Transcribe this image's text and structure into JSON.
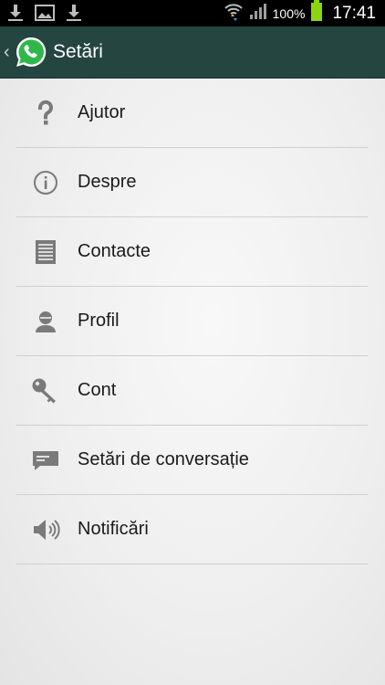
{
  "status_bar": {
    "battery_percent": "100%",
    "time": "17:41",
    "icons": [
      "download-icon",
      "image-icon",
      "download-icon",
      "wifi-icon",
      "signal-icon",
      "battery-icon"
    ]
  },
  "action_bar": {
    "title": "Setări",
    "logo": "whatsapp-logo-icon",
    "colors": {
      "background": "#244540",
      "accent": "#2fb84a"
    }
  },
  "settings": {
    "items": [
      {
        "label": "Ajutor",
        "icon": "help-icon"
      },
      {
        "label": "Despre",
        "icon": "info-icon"
      },
      {
        "label": "Contacte",
        "icon": "contacts-icon"
      },
      {
        "label": "Profil",
        "icon": "profile-icon"
      },
      {
        "label": "Cont",
        "icon": "key-icon"
      },
      {
        "label": "Setări de conversație",
        "icon": "chat-settings-icon"
      },
      {
        "label": "Notificări",
        "icon": "notifications-icon"
      }
    ]
  }
}
